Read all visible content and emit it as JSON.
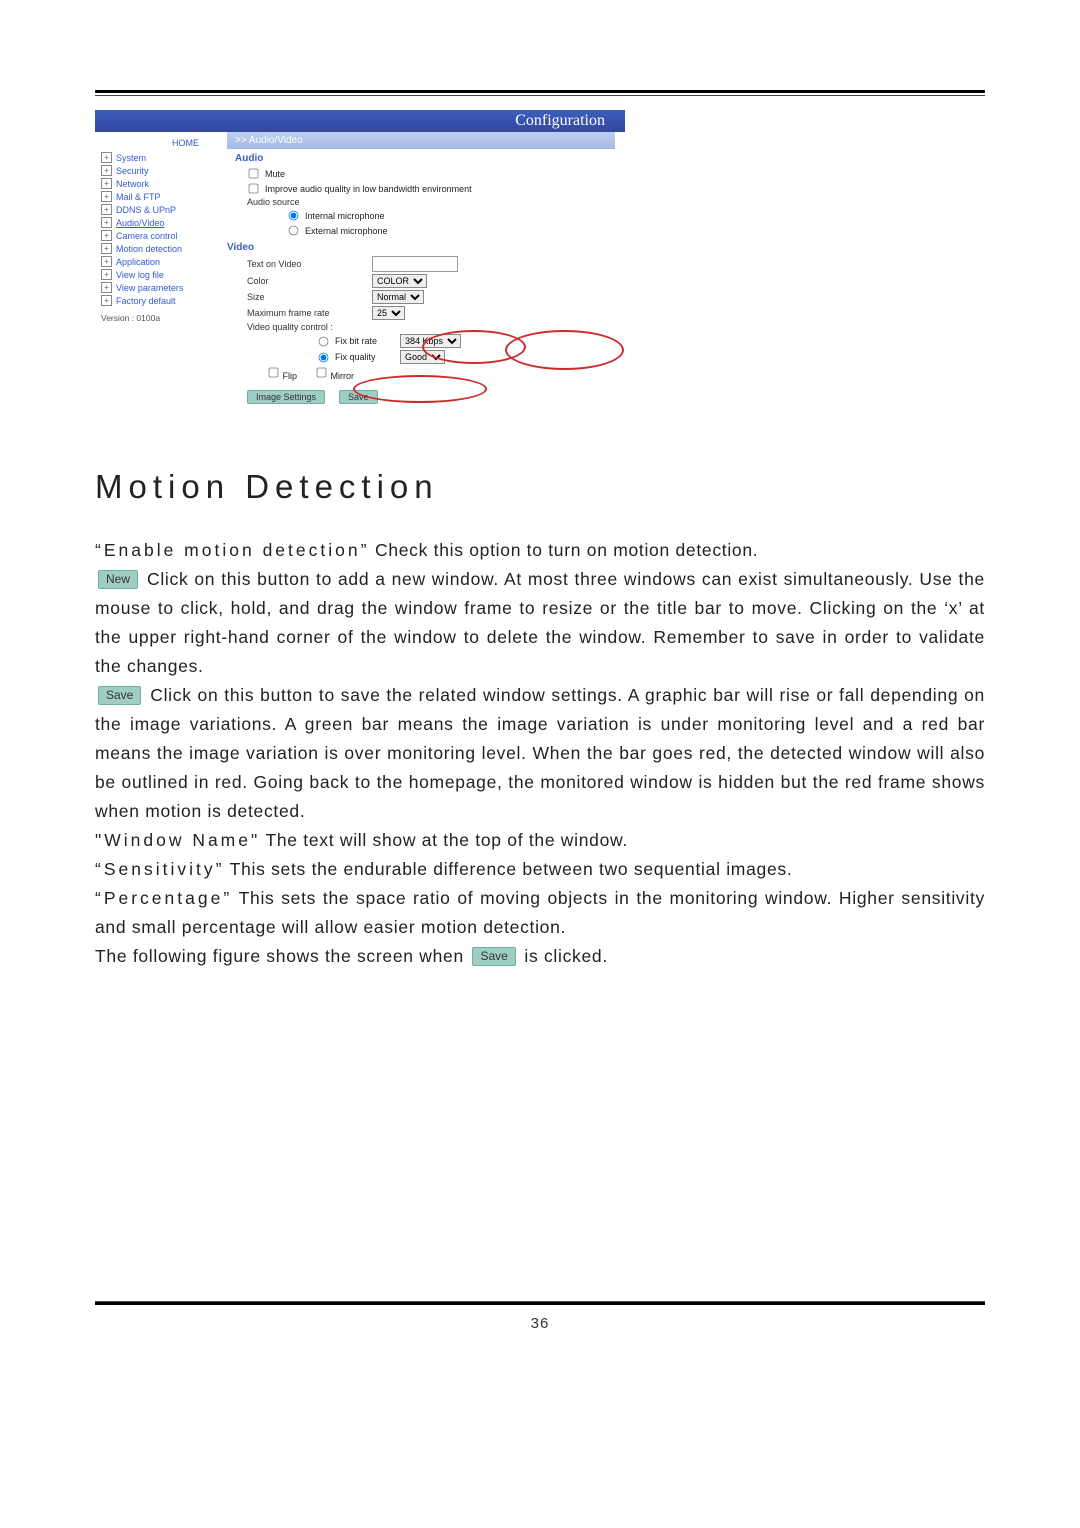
{
  "page_number": "36",
  "figure": {
    "titlebar": "Configuration",
    "crumb": ">> Audio/Video",
    "home": "HOME",
    "nav": [
      "System",
      "Security",
      "Network",
      "Mail & FTP",
      "DDNS & UPnP",
      "Audio/Video",
      "Camera control",
      "Motion detection",
      "Application",
      "View log file",
      "View parameters",
      "Factory default"
    ],
    "version": "Version : 0100a",
    "audio": {
      "section": "Audio",
      "mute": "Mute",
      "improve": "Improve audio quality in low bandwidth environment",
      "source_label": "Audio source",
      "src_internal": "Internal microphone",
      "src_external": "External microphone"
    },
    "video": {
      "section": "Video",
      "text_on_video": "Text on Video",
      "color_label": "Color",
      "color_value": "COLOR",
      "size_label": "Size",
      "size_value": "Normal",
      "max_fr": "Maximum frame rate",
      "fr_value": "25",
      "vqc_label": "Video quality control :",
      "fix_bit_rate": "Fix bit rate",
      "bit_rate_value": "384 Kbps",
      "fix_quality": "Fix quality",
      "quality_value": "Good",
      "flip": "Flip",
      "mirror": "Mirror"
    },
    "buttons": {
      "image_settings": "Image Settings",
      "save": "Save"
    }
  },
  "heading": "Motion Detection",
  "buttons": {
    "new": "New",
    "save": "Save",
    "save2": "Save"
  },
  "p1_a": "“Enable motion detection”",
  "p1_b": " Check this option to turn on motion detection.",
  "p2": " Click on this button to add a new window. At most three windows can exist simultaneously. Use the mouse to click, hold, and drag the window frame to resize or the title bar to move. Clicking on the ‘x’ at the upper right-hand corner of the window to delete the window. Remember to save in order to validate the changes.",
  "p3": " Click on this button to save the related window settings. A graphic bar will rise or fall depending on the image variations. A green bar means the image variation is under monitoring level and a red bar means the image variation is over monitoring level. When the bar goes red, the detected window will also be outlined in red. Going back to the homepage, the monitored window is hidden but the red frame shows when motion is detected.",
  "p4_a": "\"Window Name\"",
  "p4_b": " The text will show at the top of the window.",
  "p5_a": "“Sensitivity”",
  "p5_b": " This sets the endurable difference between two sequential images.",
  "p6_a": "“Percentage”",
  "p6_b": " This sets the space ratio of moving objects in the monitoring window. Higher sensitivity and small percentage will allow easier motion detection.",
  "p7_a": "The following figure shows the screen when ",
  "p7_b": " is clicked."
}
